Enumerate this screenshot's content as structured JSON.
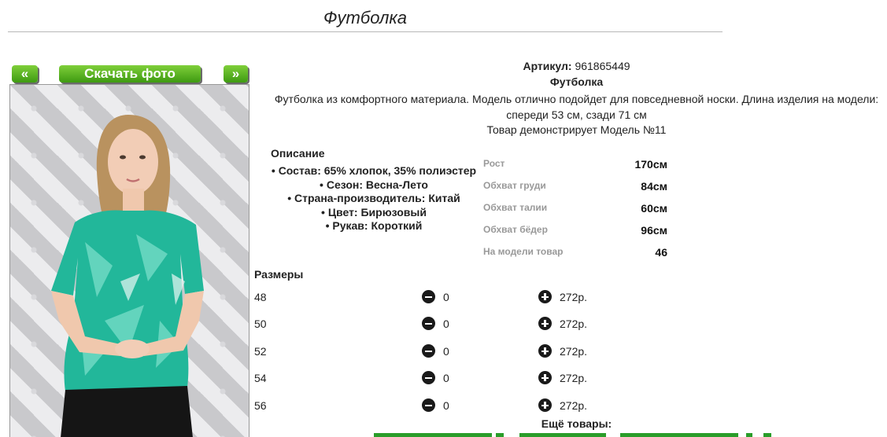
{
  "page": {
    "title": "Футболка"
  },
  "gallery": {
    "prev_label": "«",
    "download_label": "Скачать фото",
    "next_label": "»"
  },
  "product": {
    "article_label": "Артикул:",
    "article_value": "961865449",
    "name": "Футболка",
    "description": "Футболка из комфортного материала. Модель отлично подойдет для повседневной носки. Длина изделия на модели: спереди 53 см, сзади 71 см",
    "model_note": "Товар демонстрирует Модель №11"
  },
  "description_block": {
    "heading": "Описание",
    "items": [
      "Состав: 65% хлопок, 35% полиэстер",
      "Сезон: Весна-Лето",
      "Страна-производитель: Китай",
      "Цвет: Бирюзовый",
      "Рукав: Короткий"
    ]
  },
  "measurements": [
    {
      "label": "Рост",
      "value": "170см"
    },
    {
      "label": "Обхват груди",
      "value": "84см"
    },
    {
      "label": "Обхват талии",
      "value": "60см"
    },
    {
      "label": "Обхват бёдер",
      "value": "96см"
    },
    {
      "label": "На модели товар",
      "value": "46"
    }
  ],
  "sizes": {
    "heading": "Размеры",
    "rows": [
      {
        "size": "48",
        "qty": "0",
        "price": "272р."
      },
      {
        "size": "50",
        "qty": "0",
        "price": "272р."
      },
      {
        "size": "52",
        "qty": "0",
        "price": "272р."
      },
      {
        "size": "54",
        "qty": "0",
        "price": "272р."
      },
      {
        "size": "56",
        "qty": "0",
        "price": "272р."
      }
    ]
  },
  "more": {
    "heading": "Ещё товары:"
  },
  "colors": {
    "button_green": "#4aa61a",
    "shirt_turquoise": "#22b79a",
    "link_green": "#2a9d2a"
  }
}
